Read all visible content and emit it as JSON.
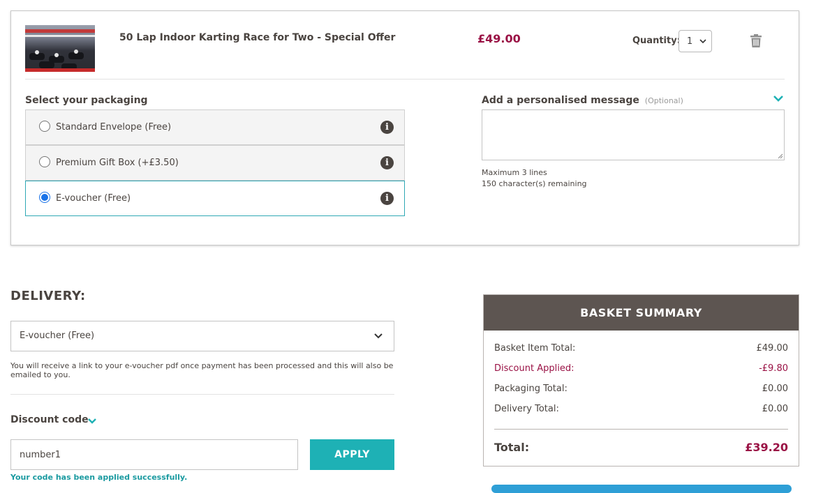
{
  "item": {
    "title": "50 Lap Indoor Karting Race for Two - Special Offer",
    "price": "£49.00",
    "quantity_label": "Quantity:",
    "quantity_value": "1"
  },
  "packaging": {
    "label": "Select your packaging",
    "options": [
      {
        "label": "Standard Envelope (Free)",
        "selected": false
      },
      {
        "label": "Premium Gift Box (+£3.50)",
        "selected": false
      },
      {
        "label": "E-voucher (Free)",
        "selected": true
      }
    ]
  },
  "message": {
    "label": "Add a personalised message",
    "optional": "(Optional)",
    "value": "",
    "max_lines": "Maximum 3 lines",
    "remaining": "150 character(s) remaining"
  },
  "delivery": {
    "heading": "DELIVERY:",
    "selected": "E-voucher (Free)",
    "note": "You will receive a link to your e-voucher pdf once payment has been processed and this will also be emailed to you."
  },
  "discount": {
    "label": "Discount code",
    "value": "number1",
    "apply_label": "APPLY",
    "success": "Your code has been applied successfully."
  },
  "summary": {
    "title": "BASKET SUMMARY",
    "rows": [
      {
        "label": "Basket Item Total:",
        "amount": "£49.00"
      },
      {
        "label": "Discount Applied:",
        "amount": "-£9.80"
      },
      {
        "label": "Packaging Total:",
        "amount": "£0.00"
      },
      {
        "label": "Delivery Total:",
        "amount": "£0.00"
      }
    ],
    "total_label": "Total:",
    "total_amount": "£39.20"
  },
  "colors": {
    "price": "#9a1245",
    "accent": "#1eb1b5",
    "summary_header": "#5d5551",
    "radio_selected": "#1a73e8"
  },
  "icons": [
    "trash-icon",
    "info-icon",
    "chevron-down-icon",
    "product-thumbnail"
  ]
}
